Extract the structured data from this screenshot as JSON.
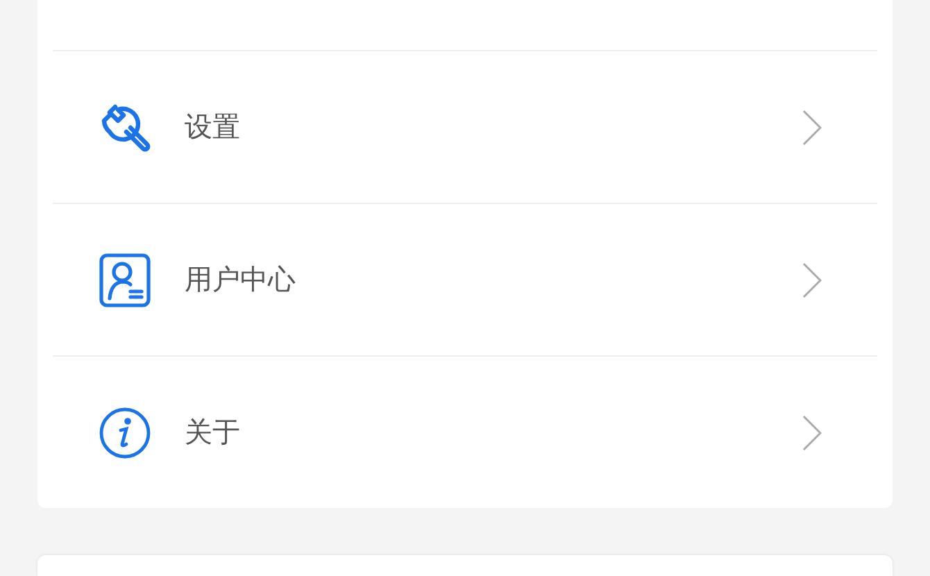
{
  "menu": [
    {
      "kind": "wrench",
      "label": "设置"
    },
    {
      "kind": "user",
      "label": "用户中心"
    },
    {
      "kind": "info",
      "label": "关于"
    }
  ]
}
